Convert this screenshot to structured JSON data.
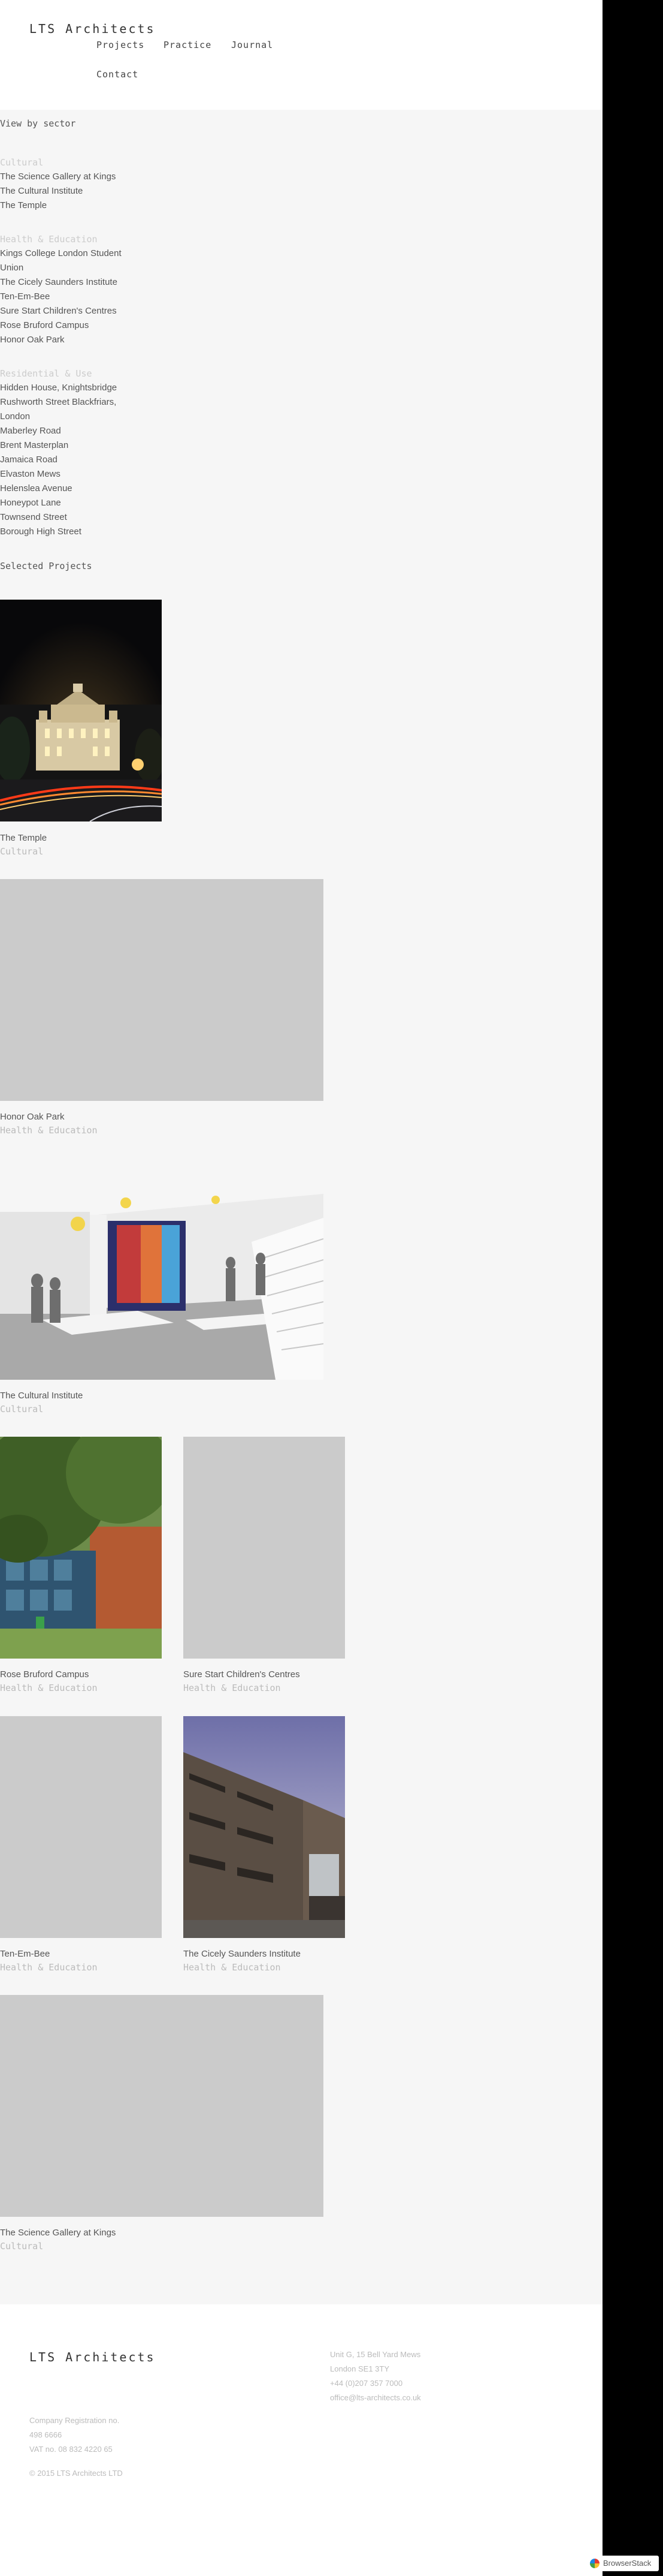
{
  "header": {
    "logo": "LTS Architects",
    "nav": [
      "Projects",
      "Practice",
      "Journal",
      "Contact"
    ]
  },
  "sectors": {
    "heading": "View by sector",
    "groups": [
      {
        "name": "Cultural",
        "items": [
          "The Science Gallery at Kings",
          "The Cultural Institute",
          "The Temple"
        ]
      },
      {
        "name": "Health & Education",
        "items": [
          "Kings College London Student",
          "Union",
          "The Cicely Saunders Institute",
          "Ten-Em-Bee",
          "Sure Start Children's Centres",
          "Rose Bruford Campus",
          "Honor Oak Park"
        ]
      },
      {
        "name": "Residential & Use",
        "items": [
          "Hidden House, Knightsbridge",
          "Rushworth Street Blackfriars,",
          "London",
          "Maberley Road",
          "Brent Masterplan",
          "Jamaica Road",
          "Elvaston Mews",
          "Helenslea Avenue",
          "Honeypot Lane",
          "Townsend Street",
          "Borough High Street"
        ]
      }
    ]
  },
  "projects": {
    "heading": "Selected Projects",
    "items": [
      {
        "title": "The Temple",
        "sector": "Cultural",
        "image": "night-building-photo"
      },
      {
        "title": "Honor Oak Park",
        "sector": "Health & Education",
        "image": "placeholder"
      },
      {
        "title": "The Cultural Institute",
        "sector": "Cultural",
        "image": "gallery-render"
      },
      {
        "title": "Rose Bruford Campus",
        "sector": "Health & Education",
        "image": "campus-photo"
      },
      {
        "title": "Sure Start Children's Centres",
        "sector": "Health & Education",
        "image": "placeholder"
      },
      {
        "title": "Ten-Em-Bee",
        "sector": "Health & Education",
        "image": "placeholder"
      },
      {
        "title": "The Cicely Saunders Institute",
        "sector": "Health & Education",
        "image": "brick-building-photo"
      },
      {
        "title": "The Science Gallery at Kings",
        "sector": "Cultural",
        "image": "placeholder"
      }
    ]
  },
  "footer": {
    "logo": "LTS Architects",
    "address": [
      "Unit G, 15 Bell Yard Mews",
      "London SE1 3TY",
      "+44 (0)207 357 7000",
      "office@lts-architects.co.uk"
    ],
    "company": [
      "Company Registration no.",
      "498 6666",
      "VAT no. 08 832 4220 65"
    ],
    "copyright": "© 2015 LTS Architects LTD"
  },
  "badge": {
    "label": "BrowserStack"
  },
  "colors": {
    "background": "#f6f6f6",
    "muted": "#bbbbbb",
    "text": "#555555",
    "placeholder": "#cbcbcb",
    "side": "#000000"
  }
}
